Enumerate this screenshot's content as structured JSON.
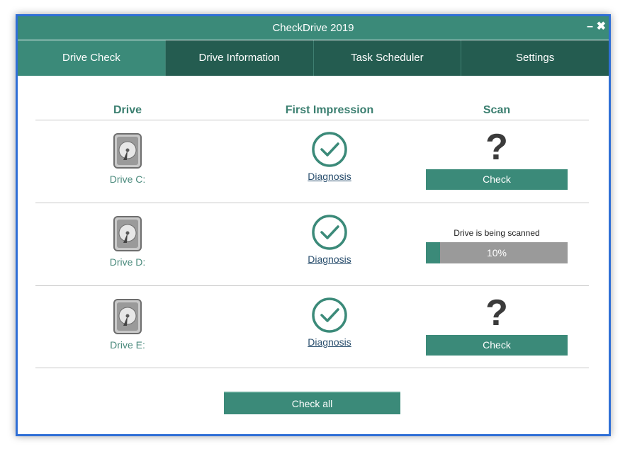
{
  "window": {
    "title": "CheckDrive 2019",
    "minimize_label": "–",
    "close_label": "✖"
  },
  "tabs": [
    {
      "label": "Drive Check",
      "active": true
    },
    {
      "label": "Drive Information",
      "active": false
    },
    {
      "label": "Task Scheduler",
      "active": false
    },
    {
      "label": "Settings",
      "active": false
    }
  ],
  "table": {
    "headers": {
      "drive": "Drive",
      "first_impression": "First Impression",
      "scan": "Scan"
    },
    "rows": [
      {
        "drive": "Drive C:",
        "drive_icon": "hard-disk-icon",
        "first_impression_icon": "check-circle-icon",
        "diagnosis_label": "Diagnosis",
        "scan_state": "unknown",
        "scan_icon": "question-mark",
        "scan_symbol": "?",
        "button_label": "Check"
      },
      {
        "drive": "Drive D:",
        "drive_icon": "hard-disk-icon",
        "first_impression_icon": "check-circle-icon",
        "diagnosis_label": "Diagnosis",
        "scan_state": "scanning",
        "scan_status": "Drive is being scanned",
        "progress_percent": 10,
        "progress_label": "10%"
      },
      {
        "drive": "Drive E:",
        "drive_icon": "hard-disk-icon",
        "first_impression_icon": "check-circle-icon",
        "diagnosis_label": "Diagnosis",
        "scan_state": "unknown",
        "scan_icon": "question-mark",
        "scan_symbol": "?",
        "button_label": "Check"
      }
    ]
  },
  "footer": {
    "check_all_label": "Check all"
  },
  "colors": {
    "accent": "#3b8a79",
    "tab_dark": "#245c50",
    "header_text": "#3b7f70",
    "progress_track": "#9a9a9a",
    "window_border": "#2f6fd6"
  }
}
